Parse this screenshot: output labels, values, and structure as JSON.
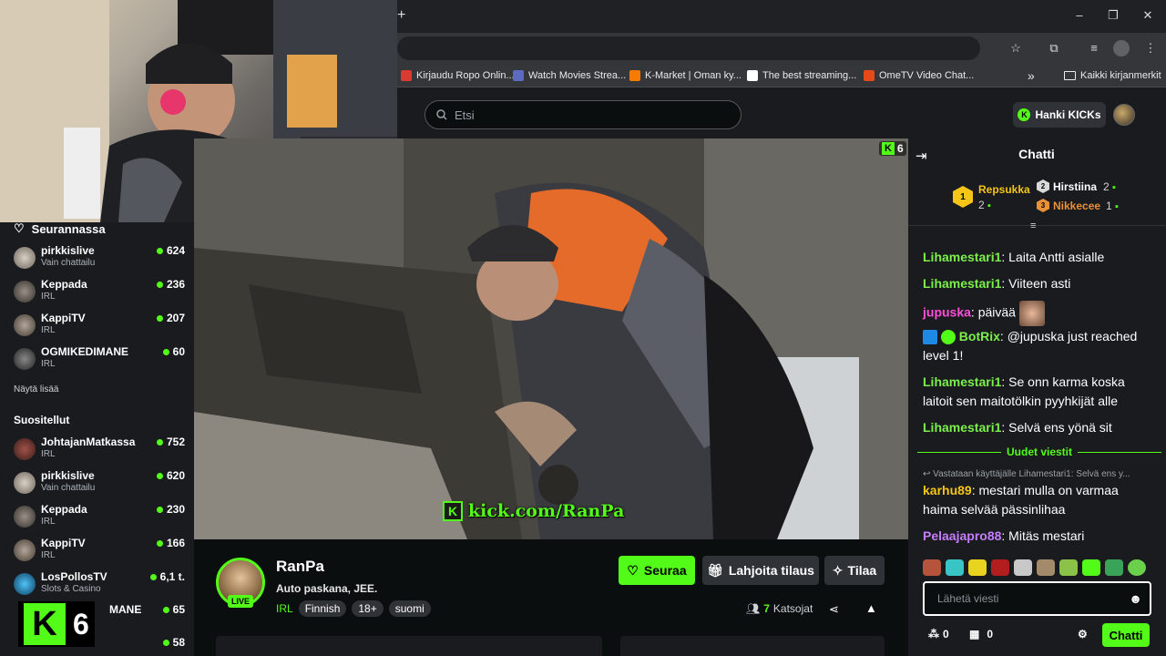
{
  "browser": {
    "new_tab_icon": "plus-icon",
    "bookmarks": [
      {
        "label": "Kirjaudu Ropo Onlin...",
        "color": "#d93b30"
      },
      {
        "label": "Watch Movies Strea...",
        "color": "#5c6bc0"
      },
      {
        "label": "K-Market | Oman ky...",
        "color": "#f57c00"
      },
      {
        "label": "The best streaming...",
        "color": "#ffffff"
      },
      {
        "label": "OmeTV Video Chat...",
        "color": "#e64a19"
      }
    ],
    "all_bookmarks": "Kaikki kirjanmerkit"
  },
  "header": {
    "search_placeholder": "Etsi",
    "hanki_label": "Hanki KICKs"
  },
  "sidebar": {
    "following_title": "Seurannassa",
    "following": [
      {
        "name": "pirkkislive",
        "category": "Vain chattailu",
        "viewers": "624"
      },
      {
        "name": "Keppada",
        "category": "IRL",
        "viewers": "236"
      },
      {
        "name": "KappiTV",
        "category": "IRL",
        "viewers": "207"
      },
      {
        "name": "OGMIKEDIMANE",
        "category": "IRL",
        "viewers": "60"
      }
    ],
    "show_more": "Näytä lisää",
    "recommended_title": "Suositellut",
    "recommended": [
      {
        "name": "JohtajanMatkassa",
        "category": "IRL",
        "viewers": "752"
      },
      {
        "name": "pirkkislive",
        "category": "Vain chattailu",
        "viewers": "620"
      },
      {
        "name": "Keppada",
        "category": "IRL",
        "viewers": "230"
      },
      {
        "name": "KappiTV",
        "category": "IRL",
        "viewers": "166"
      },
      {
        "name": "LosPollosTV",
        "category": "Slots & Casino",
        "viewers": "6,1 t."
      },
      {
        "name": "MANE",
        "category": "",
        "viewers": "65"
      },
      {
        "name": "",
        "category": "",
        "viewers": "58"
      }
    ]
  },
  "video": {
    "watermark": "kick.com/RanPa",
    "corner_count": "6",
    "overlay_count": "6"
  },
  "stream": {
    "streamer": "RanPa",
    "live": "LIVE",
    "title": "Auto paskana, JEE.",
    "category": "IRL",
    "tags": [
      "Finnish",
      "18+",
      "suomi"
    ],
    "follow_label": "Seuraa",
    "gift_label": "Lahjoita tilaus",
    "subscribe_label": "Tilaa",
    "viewers": "7",
    "viewers_label": "Katsojat"
  },
  "chat": {
    "title": "Chatti",
    "leaderboard": [
      {
        "rank": "1",
        "name": "Repsukka",
        "count": "2",
        "color": "#f5c518"
      },
      {
        "rank": "2",
        "name": "Hirstiina",
        "count": "2",
        "color": "#d9d9d9"
      },
      {
        "rank": "3",
        "name": "Nikkecee",
        "count": "1",
        "color": "#e8903a"
      }
    ],
    "messages": [
      {
        "user": "Lihamestari1",
        "color": "#7cf04a",
        "text": "Laita Antti asialle"
      },
      {
        "user": "Lihamestari1",
        "color": "#7cf04a",
        "text": "Viiteen asti"
      },
      {
        "user": "jupuska",
        "color": "#ff4fd8",
        "text": "päivää"
      },
      {
        "user": "BotRix",
        "color": "#7cf04a",
        "text": "@jupuska just reached level 1!"
      },
      {
        "user": "Lihamestari1",
        "color": "#7cf04a",
        "text": "Se onn karma koska laitoit sen maitotölkin pyyhkijät alle"
      },
      {
        "user": "Lihamestari1",
        "color": "#7cf04a",
        "text": "Selvä ens yönä sit"
      },
      {
        "user": "karhu89",
        "color": "#f5c518",
        "text": "mestari mulla on varmaa haima selvää pässinlihaa"
      },
      {
        "user": "Pelaajapro88",
        "color": "#c77dff",
        "text": "Mitäs mestari"
      }
    ],
    "new_messages": "Uudet viestit",
    "reply_hint": "Vastataan käyttäjälle Lihamestari1: Selvä ens y...",
    "input_placeholder": "Lähetä viesti",
    "kicks_count": "0",
    "store_count": "0",
    "send_label": "Chatti"
  }
}
